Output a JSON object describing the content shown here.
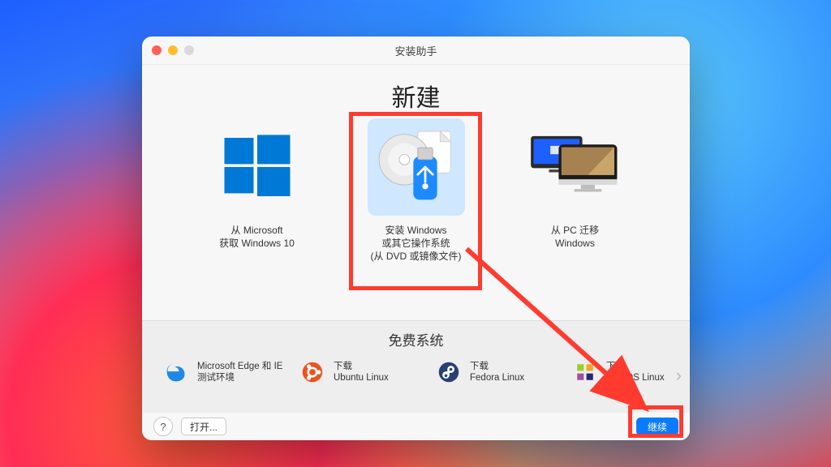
{
  "titlebar": {
    "title": "安装助手"
  },
  "heading": "新建",
  "options": [
    {
      "id": "get-from-ms",
      "label_line1": "从 Microsoft",
      "label_line2": "获取 Windows 10"
    },
    {
      "id": "install-iso",
      "label_line1": "安装 Windows",
      "label_line2": "或其它操作系统",
      "label_line3": "(从 DVD 或镜像文件)"
    },
    {
      "id": "transfer-pc",
      "label_line1": "从 PC 迁移",
      "label_line2": "Windows"
    }
  ],
  "free_section": {
    "title": "免费系统",
    "items": [
      {
        "id": "edge-ie",
        "line1": "Microsoft Edge 和 IE",
        "line2": "测试环境"
      },
      {
        "id": "ubuntu",
        "line1": "下载",
        "line2": "Ubuntu Linux"
      },
      {
        "id": "fedora",
        "line1": "下载",
        "line2": "Fedora Linux"
      },
      {
        "id": "centos",
        "line1": "下载",
        "line2": "CentOS Linux"
      }
    ]
  },
  "footer": {
    "help_label": "?",
    "open_label": "打开...",
    "continue_label": "继续"
  }
}
